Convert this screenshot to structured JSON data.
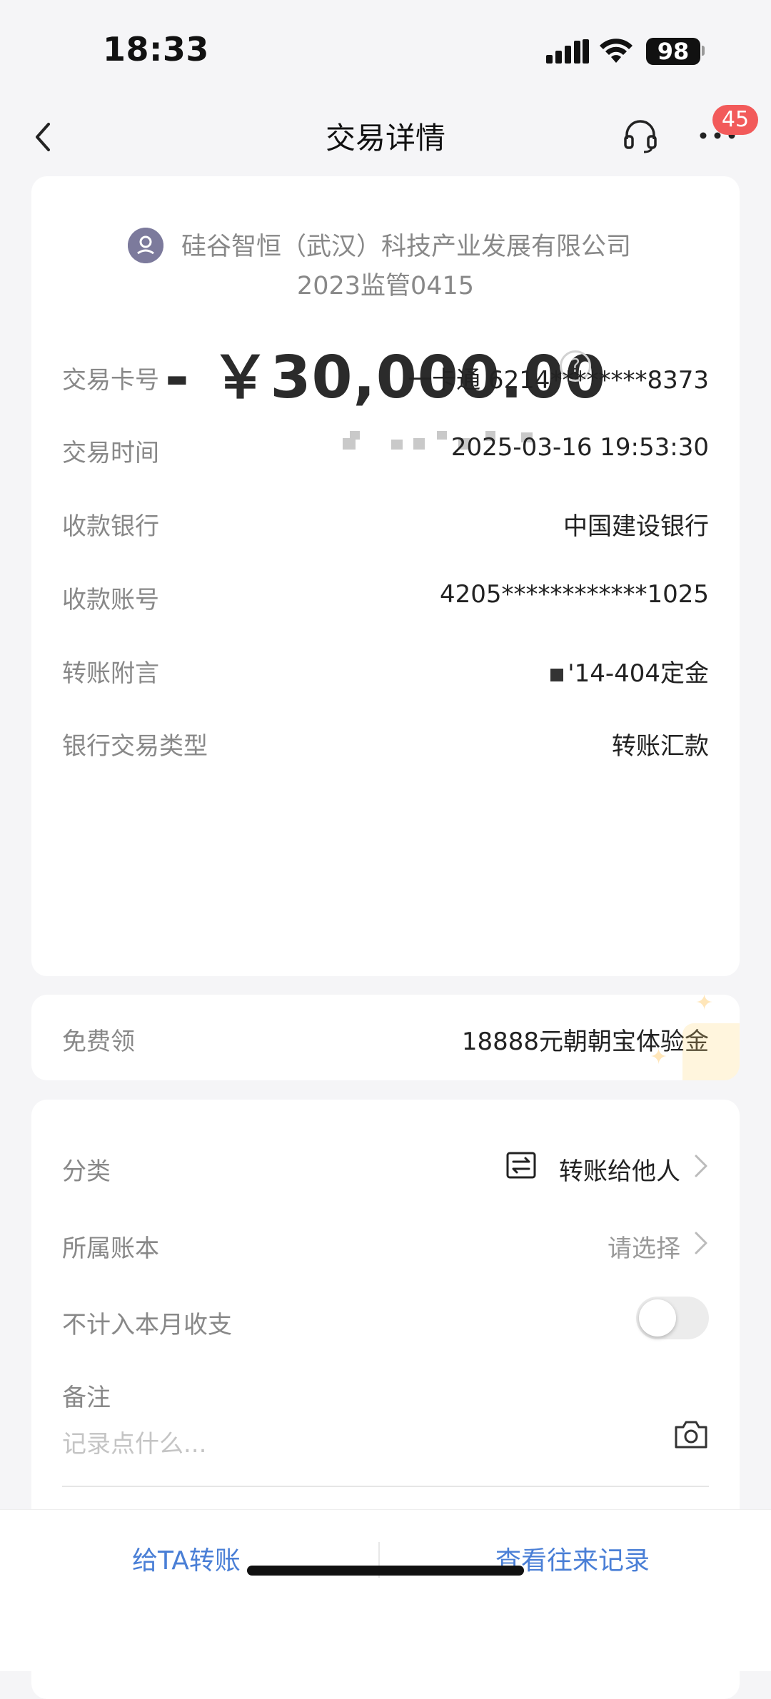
{
  "status_bar": {
    "time": "18:33",
    "battery": "98"
  },
  "nav": {
    "title": "交易详情",
    "badge": "45"
  },
  "transaction": {
    "payee_line1": "硅谷智恒（武汉）科技产业发展有限公司",
    "payee_line2": "2023监管0415",
    "amount": "- ￥30,000.00",
    "help_glyph": "?",
    "status_obscured": true
  },
  "details": [
    {
      "label": "交易卡号",
      "value": "一卡通 6214********8373"
    },
    {
      "label": "交易时间",
      "value": "2025-03-16 19:53:30"
    },
    {
      "label": "收款银行",
      "value": "中国建设银行"
    },
    {
      "label": "收款账号",
      "value": "4205************1025"
    },
    {
      "label": "转账附言",
      "value": "'14-404定金"
    },
    {
      "label": "银行交易类型",
      "value": "转账汇款"
    }
  ],
  "promo": {
    "label": "免费领",
    "value": "18888元朝朝宝体验金"
  },
  "category": {
    "category_label": "分类",
    "category_value": "转账给他人",
    "ledger_label": "所属账本",
    "ledger_value": "请选择",
    "exclude_label": "不计入本月收支",
    "exclude_toggle_on": false,
    "note_label": "备注",
    "note_placeholder": "记录点什么..."
  },
  "bottom": {
    "transfer_button": "给TA转账",
    "history_button": "查看往来记录"
  },
  "colors": {
    "accent": "#4a7fd6",
    "badge": "#f25a5a",
    "background": "#f5f5f7"
  },
  "icons": [
    "back-arrow-icon",
    "headset-icon",
    "more-icon",
    "avatar-icon",
    "help-icon",
    "transfer-icon",
    "chevron-right-icon",
    "camera-icon"
  ]
}
